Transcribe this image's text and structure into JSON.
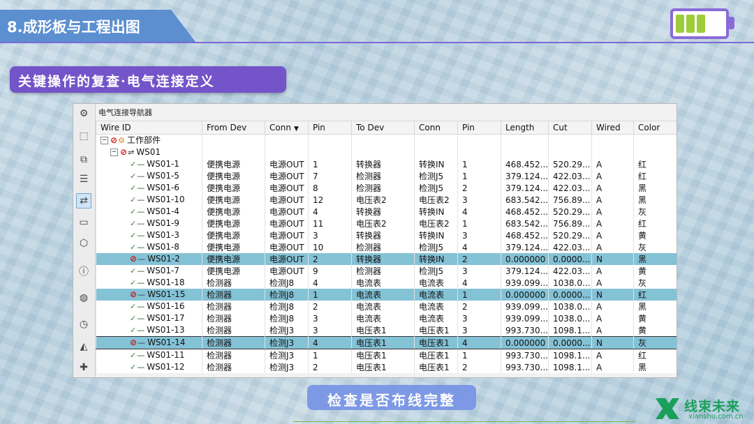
{
  "slide": {
    "section_title": "8.成形板与工程出图",
    "subtitle": "关键操作的复查·电气连接定义",
    "bottom_caption": "检查是否布线完整",
    "logo_text": "线束未来",
    "logo_url": "xianshu.com.cn",
    "battery_cells": 3,
    "colors": {
      "accent": "#7454c9",
      "title_band": "#5b8fd0",
      "selected_row": "#84c2d6",
      "logo": "#1aa05a"
    }
  },
  "navigator": {
    "title": "电气连接导航器",
    "toolbar_icons": [
      "gear-icon",
      "part-icon",
      "assembly-icon",
      "layer-icon",
      "connection-navigator-icon",
      "component-icon",
      "box-icon",
      "info-icon",
      "web-icon",
      "clock-icon",
      "palette-icon",
      "tools-icon"
    ],
    "columns": [
      "Wire ID",
      "From Dev",
      "Conn",
      "Pin",
      "To Dev",
      "Conn",
      "Pin",
      "Length",
      "Cut",
      "Wired",
      "Color"
    ],
    "sort_column_indicator": "▼",
    "tree": {
      "root": "工作部件",
      "group": "WS01"
    },
    "rows": [
      {
        "id": "WS01-1",
        "from": "便携电源",
        "conn": "电源OUT",
        "pin": "1",
        "to": "转换器",
        "conn2": "转换IN",
        "pin2": "1",
        "length": "468.452...",
        "cut": "520.29...",
        "wired": "A",
        "color": "红",
        "status": "ok"
      },
      {
        "id": "WS01-5",
        "from": "便携电源",
        "conn": "电源OUT",
        "pin": "7",
        "to": "检测器",
        "conn2": "检测J5",
        "pin2": "1",
        "length": "379.124...",
        "cut": "422.03...",
        "wired": "A",
        "color": "红",
        "status": "ok"
      },
      {
        "id": "WS01-6",
        "from": "便携电源",
        "conn": "电源OUT",
        "pin": "8",
        "to": "检测器",
        "conn2": "检测J5",
        "pin2": "2",
        "length": "379.124...",
        "cut": "422.03...",
        "wired": "A",
        "color": "黑",
        "status": "ok"
      },
      {
        "id": "WS01-10",
        "from": "便携电源",
        "conn": "电源OUT",
        "pin": "12",
        "to": "电压表2",
        "conn2": "电压表2",
        "pin2": "3",
        "length": "683.542...",
        "cut": "756.89...",
        "wired": "A",
        "color": "黑",
        "status": "ok"
      },
      {
        "id": "WS01-4",
        "from": "便携电源",
        "conn": "电源OUT",
        "pin": "4",
        "to": "转换器",
        "conn2": "转换IN",
        "pin2": "4",
        "length": "468.452...",
        "cut": "520.29...",
        "wired": "A",
        "color": "灰",
        "status": "ok"
      },
      {
        "id": "WS01-9",
        "from": "便携电源",
        "conn": "电源OUT",
        "pin": "11",
        "to": "电压表2",
        "conn2": "电压表2",
        "pin2": "1",
        "length": "683.542...",
        "cut": "756.89...",
        "wired": "A",
        "color": "红",
        "status": "ok"
      },
      {
        "id": "WS01-3",
        "from": "便携电源",
        "conn": "电源OUT",
        "pin": "3",
        "to": "转换器",
        "conn2": "转换IN",
        "pin2": "3",
        "length": "468.452...",
        "cut": "520.29...",
        "wired": "A",
        "color": "黄",
        "status": "ok"
      },
      {
        "id": "WS01-8",
        "from": "便携电源",
        "conn": "电源OUT",
        "pin": "10",
        "to": "检测器",
        "conn2": "检测J5",
        "pin2": "4",
        "length": "379.124...",
        "cut": "422.03...",
        "wired": "A",
        "color": "灰",
        "status": "ok"
      },
      {
        "id": "WS01-2",
        "from": "便携电源",
        "conn": "电源OUT",
        "pin": "2",
        "to": "转换器",
        "conn2": "转换IN",
        "pin2": "2",
        "length": "0.000000",
        "cut": "0.0000...",
        "wired": "N",
        "color": "黑",
        "status": "error",
        "selected": true
      },
      {
        "id": "WS01-7",
        "from": "便携电源",
        "conn": "电源OUT",
        "pin": "9",
        "to": "检测器",
        "conn2": "检测J5",
        "pin2": "3",
        "length": "379.124...",
        "cut": "422.03...",
        "wired": "A",
        "color": "黄",
        "status": "ok"
      },
      {
        "id": "WS01-18",
        "from": "检测器",
        "conn": "检测J8",
        "pin": "4",
        "to": "电流表",
        "conn2": "电流表",
        "pin2": "4",
        "length": "939.099...",
        "cut": "1038.0...",
        "wired": "A",
        "color": "灰",
        "status": "ok"
      },
      {
        "id": "WS01-15",
        "from": "检测器",
        "conn": "检测J8",
        "pin": "1",
        "to": "电流表",
        "conn2": "电流表",
        "pin2": "1",
        "length": "0.000000",
        "cut": "0.0000...",
        "wired": "N",
        "color": "红",
        "status": "error",
        "selected": true
      },
      {
        "id": "WS01-16",
        "from": "检测器",
        "conn": "检测J8",
        "pin": "2",
        "to": "电流表",
        "conn2": "电流表",
        "pin2": "2",
        "length": "939.099...",
        "cut": "1038.0...",
        "wired": "A",
        "color": "黑",
        "status": "ok"
      },
      {
        "id": "WS01-17",
        "from": "检测器",
        "conn": "检测J8",
        "pin": "3",
        "to": "电流表",
        "conn2": "电流表",
        "pin2": "3",
        "length": "939.099...",
        "cut": "1038.0...",
        "wired": "A",
        "color": "黄",
        "status": "ok"
      },
      {
        "id": "WS01-13",
        "from": "检测器",
        "conn": "检测J3",
        "pin": "3",
        "to": "电压表1",
        "conn2": "电压表1",
        "pin2": "3",
        "length": "993.730...",
        "cut": "1098.1...",
        "wired": "A",
        "color": "黄",
        "status": "ok"
      },
      {
        "id": "WS01-14",
        "from": "检测器",
        "conn": "检测J3",
        "pin": "4",
        "to": "电压表1",
        "conn2": "电压表1",
        "pin2": "4",
        "length": "0.000000",
        "cut": "0.0000...",
        "wired": "N",
        "color": "灰",
        "status": "error",
        "selected": true,
        "boxed": true
      },
      {
        "id": "WS01-11",
        "from": "检测器",
        "conn": "检测J3",
        "pin": "1",
        "to": "电压表1",
        "conn2": "电压表1",
        "pin2": "1",
        "length": "993.730...",
        "cut": "1098.1...",
        "wired": "A",
        "color": "红",
        "status": "ok"
      },
      {
        "id": "WS01-12",
        "from": "检测器",
        "conn": "检测J3",
        "pin": "2",
        "to": "电压表1",
        "conn2": "电压表1",
        "pin2": "2",
        "length": "993.730...",
        "cut": "1098.1...",
        "wired": "A",
        "color": "黑",
        "status": "ok"
      }
    ]
  }
}
